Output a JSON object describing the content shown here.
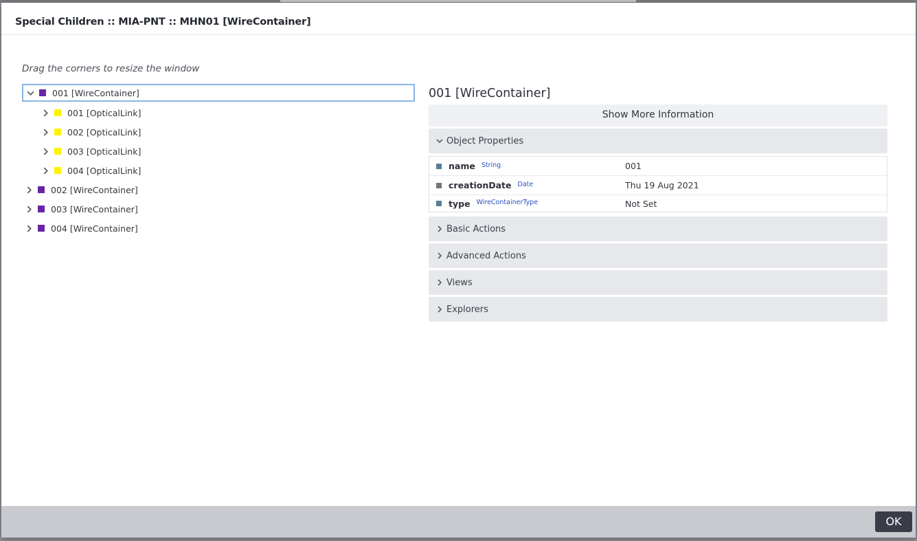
{
  "dialog": {
    "title": "Special Children :: MIA-PNT :: MHN01 [WireContainer]",
    "hint": "Drag the corners to resize the window",
    "ok_label": "OK"
  },
  "tree": {
    "items": [
      {
        "label": "001 [WireContainer]",
        "level": 0,
        "expanded": true,
        "selected": true,
        "color": "#6a24a4"
      },
      {
        "label": "001 [OpticalLink]",
        "level": 1,
        "expanded": false,
        "selected": false,
        "color": "#fff200"
      },
      {
        "label": "002 [OpticalLink]",
        "level": 1,
        "expanded": false,
        "selected": false,
        "color": "#fff200"
      },
      {
        "label": "003 [OpticalLink]",
        "level": 1,
        "expanded": false,
        "selected": false,
        "color": "#fff200"
      },
      {
        "label": "004 [OpticalLink]",
        "level": 1,
        "expanded": false,
        "selected": false,
        "color": "#fff200"
      },
      {
        "label": "002 [WireContainer]",
        "level": 0,
        "expanded": false,
        "selected": false,
        "color": "#6a24a4"
      },
      {
        "label": "003 [WireContainer]",
        "level": 0,
        "expanded": false,
        "selected": false,
        "color": "#6a24a4"
      },
      {
        "label": "004 [WireContainer]",
        "level": 0,
        "expanded": false,
        "selected": false,
        "color": "#6a24a4"
      }
    ]
  },
  "detail": {
    "title": "001 [WireContainer]",
    "more_info_label": "Show More Information",
    "object_properties_label": "Object Properties",
    "properties": [
      {
        "name": "name",
        "type": "String",
        "value": "001"
      },
      {
        "name": "creationDate",
        "type": "Date",
        "value": "Thu 19 Aug 2021"
      },
      {
        "name": "type",
        "type": "WireContainerType",
        "value": "Not Set"
      }
    ],
    "sections": {
      "basic_actions": "Basic Actions",
      "advanced_actions": "Advanced Actions",
      "views": "Views",
      "explorers": "Explorers"
    }
  },
  "colors": {
    "wirecontainer": "#6a24a4",
    "opticallink": "#fff200",
    "selection_border": "#8ab4e6",
    "type_link": "#2b4fc2",
    "ok_button": "#3a3d47"
  }
}
